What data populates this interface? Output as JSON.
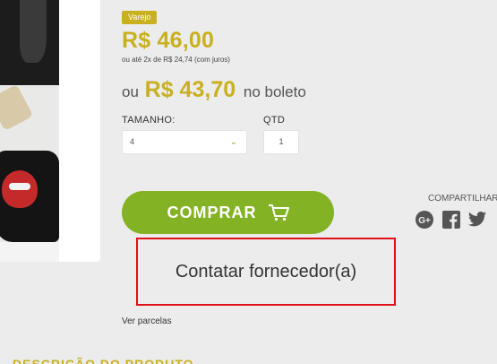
{
  "product": {
    "badge": "Varejo",
    "price": "R$ 46,00",
    "installments": "ou até 2x de R$ 24,74 (com juros)",
    "boleto_prefix": "ou",
    "boleto_price": "R$ 43,70",
    "boleto_suffix": "no boleto"
  },
  "options": {
    "size_label": "TAMANHO:",
    "size_value": "4",
    "qty_label": "QTD",
    "qty_value": "1"
  },
  "actions": {
    "buy_label": "COMPRAR",
    "contact_label": "Contatar fornecedor(a)",
    "parcelas_link": "Ver parcelas"
  },
  "share": {
    "label": "COMPARTILHAR",
    "icons": [
      "google-plus-icon",
      "facebook-icon",
      "twitter-icon"
    ]
  },
  "section": {
    "heading": "DESCRIÇÃO DO PRODUTO"
  },
  "colors": {
    "accent_gold": "#c9b01e",
    "buy_green": "#84b225",
    "highlight_red": "#e0101a"
  }
}
